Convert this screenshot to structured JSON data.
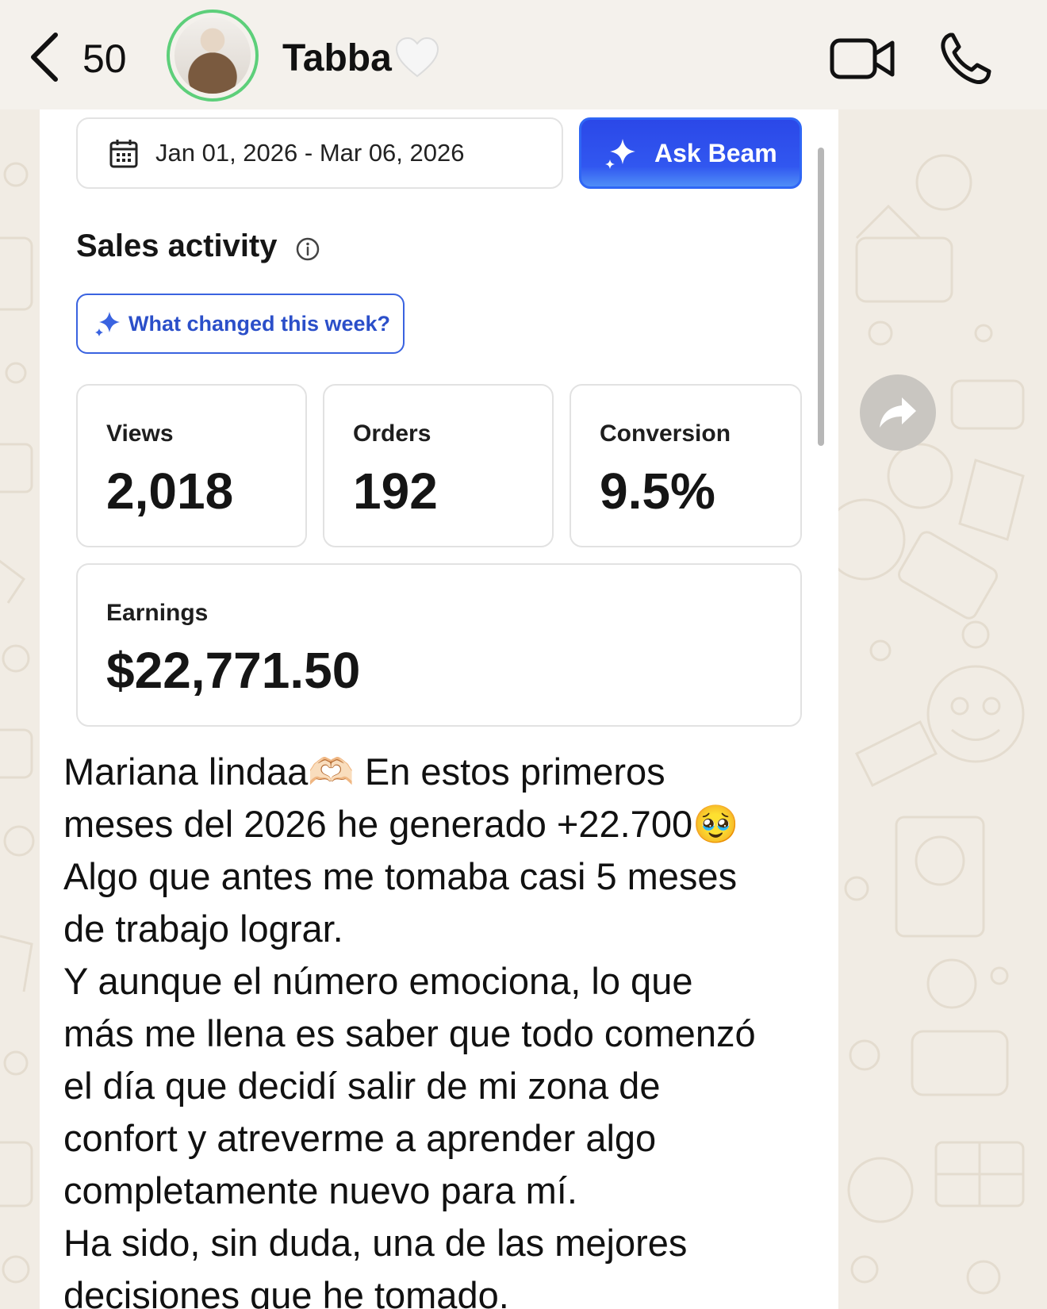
{
  "header": {
    "back_count": "50",
    "contact_name": "Tabba",
    "status_ring_color": "#5dcf7a"
  },
  "dashboard": {
    "date_range": "Jan 01, 2026 - Mar 06, 2026",
    "ask_button_label": "Ask Beam",
    "section_title": "Sales activity",
    "changed_button_label": "What changed this week?",
    "accent_color": "#2f66f5",
    "stats": [
      {
        "label": "Views",
        "value": "2,018"
      },
      {
        "label": "Orders",
        "value": "192"
      },
      {
        "label": "Conversion",
        "value": "9.5%"
      }
    ],
    "earnings": {
      "label": "Earnings",
      "value": "$22,771.50"
    }
  },
  "message": {
    "lines": [
      "Mariana lindaa🫶🏻 En estos primeros",
      "meses del 2026 he generado +22.700🥹",
      "Algo que antes me tomaba casi 5 meses",
      "de trabajo lograr.",
      "Y aunque el número emociona, lo que",
      "más me llena es saber que todo comenzó",
      "el día que decidí salir de mi zona de",
      "confort y atreverme a aprender algo",
      "completamente nuevo para mí.",
      "Ha sido, sin duda, una de las mejores",
      "decisiones que he tomado."
    ]
  },
  "icons": {
    "back": "chevron-left-icon",
    "heart": "white-heart-icon",
    "video": "video-camera-icon",
    "phone": "phone-icon",
    "calendar": "calendar-icon",
    "sparkle": "sparkle-icon",
    "info": "info-icon",
    "forward": "forward-arrow-icon"
  }
}
